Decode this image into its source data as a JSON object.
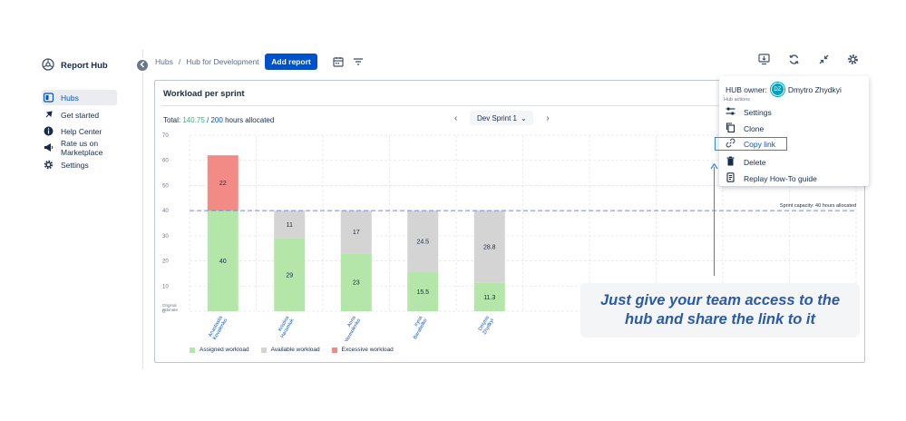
{
  "sidebar": {
    "logo": "Report Hub",
    "items": [
      {
        "label": "Hubs",
        "icon": "hubs-icon",
        "active": true
      },
      {
        "label": "Get started",
        "icon": "pin-icon"
      },
      {
        "label": "Help Center",
        "icon": "info-icon"
      },
      {
        "label": "Rate us on Marketplace",
        "icon": "megaphone-icon"
      },
      {
        "label": "Settings",
        "icon": "gear-icon"
      }
    ]
  },
  "breadcrumb": {
    "root": "Hubs",
    "sep": "/",
    "current": "Hub for Development"
  },
  "toolbar": {
    "add_report": "Add report"
  },
  "card": {
    "title": "Workload per sprint",
    "total_prefix": "Total: ",
    "total_allocated": "140.75",
    "total_sep": " / ",
    "total_capacity": "200",
    "total_suffix": " hours allocated",
    "sprint": "Dev Sprint 1",
    "sprint_caret": "⌄",
    "prev": "‹",
    "next": "›"
  },
  "chart_data": {
    "type": "bar",
    "stacked": true,
    "ylim": [
      0,
      70
    ],
    "yticks": [
      "0",
      "10",
      "20",
      "30",
      "40",
      "50",
      "60",
      "70"
    ],
    "y_bottom_label": [
      "Original",
      "estimate"
    ],
    "categories": [
      [
        "Anastasiia",
        "Kovalenko"
      ],
      [
        "Kristina",
        "Haramiuk"
      ],
      [
        "Anna",
        "Yermolenko"
      ],
      [
        "Iryna",
        "Barabolko"
      ],
      [
        "Dmytro",
        "Zhydkyi"
      ]
    ],
    "series": [
      {
        "name": "Assigned workload",
        "color": "#b3e6a8",
        "values": [
          40,
          29,
          23,
          15.5,
          11.3
        ],
        "labels": [
          "40",
          "29",
          "23",
          "15.5",
          "11.3"
        ]
      },
      {
        "name": "Available workload",
        "color": "#d4d4d4",
        "values": [
          0,
          11,
          17,
          24.5,
          28.8
        ],
        "labels": [
          "",
          "11",
          "17",
          "24.5",
          "28.8"
        ]
      },
      {
        "name": "Excessive workload",
        "color": "#f28b86",
        "values": [
          22,
          0,
          0,
          0,
          0
        ],
        "labels": [
          "22",
          "",
          "",
          "",
          ""
        ]
      }
    ],
    "capacity_line": {
      "value": 40,
      "label": "Sprint capacity: 40 hours allocated"
    }
  },
  "menu": {
    "owner_prefix": "HUB owner:",
    "owner_initials": "DZ",
    "owner_name": "Dmytro Zhydkyi",
    "section": "Hub actions",
    "items": [
      {
        "label": "Settings",
        "icon": "sliders-icon"
      },
      {
        "label": "Clone",
        "icon": "copy-icon"
      },
      {
        "label": "Copy link",
        "icon": "link-icon",
        "highlighted": true
      },
      {
        "label": "Delete",
        "icon": "trash-icon"
      },
      {
        "label": "Replay How-To guide",
        "icon": "document-icon"
      }
    ]
  },
  "callout": {
    "line1": "Just give your team access to the",
    "line2": "hub and share the link to it"
  },
  "colors": {
    "accent": "#0052cc",
    "capacity_line": "#6b8cf5",
    "callout_text": "#2a5aa8"
  }
}
